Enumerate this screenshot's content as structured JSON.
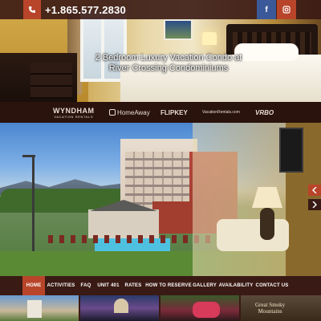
{
  "header": {
    "phone": "+1.865.577.2830",
    "social": [
      "facebook-icon",
      "instagram-icon"
    ]
  },
  "hero": {
    "title_line1": "2 Bedroom Luxury Vacation Condo at",
    "title_line2": "River Crossing Condominiums"
  },
  "partners": {
    "wyndham": "WYNDHAM",
    "wyndham_sub": "VACATION RENTALS",
    "homeaway": "HomeAway",
    "flipkey": "FLIPKEY",
    "vacationrentals": "VacationRentals.com",
    "vrbo": "VRBO"
  },
  "nav": {
    "items": [
      "HOME",
      "ACTIVITIES",
      "FAQ",
      "UNIT 401",
      "RATES",
      "HOW TO RESERVE",
      "GALLERY",
      "AVAILABILITY",
      "CONTACT US"
    ],
    "active_index": 0
  },
  "slider": {
    "prev_icon": "chevron-left-icon",
    "next_icon": "chevron-right-icon"
  },
  "thumbs": {
    "gsm_line1": "Great Smoky",
    "gsm_line2": "Mountains"
  },
  "colors": {
    "accent": "#b8452a",
    "bar": "#3a1a14",
    "facebook": "#3b5998"
  }
}
